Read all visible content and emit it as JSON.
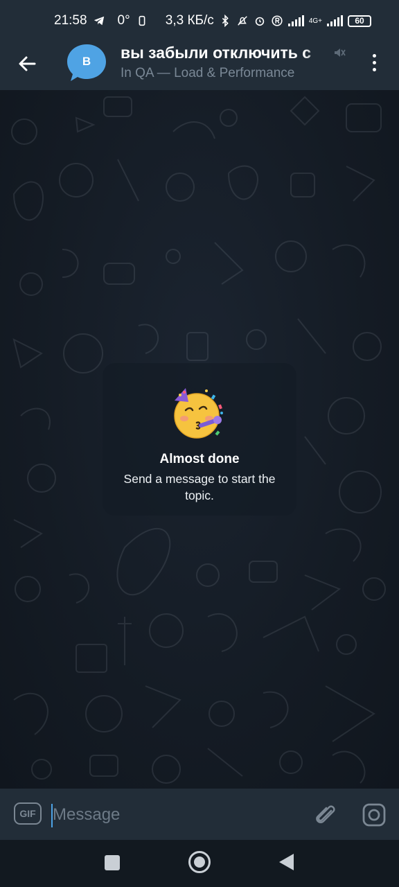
{
  "status_bar": {
    "time": "21:58",
    "temperature": "0°",
    "network_speed": "3,3 КБ/с",
    "network_type": "4G+",
    "battery": "60"
  },
  "header": {
    "avatar_letter": "B",
    "title": "вы забыли отключить с",
    "subtitle": "In QA — Load & Performance"
  },
  "empty_state": {
    "title": "Almost done",
    "subtitle": "Send a message to start the topic."
  },
  "composer": {
    "gif_label": "GIF",
    "placeholder": "Message"
  },
  "colors": {
    "accent": "#4da3e6",
    "avatar": "#4fa3e4",
    "header_bg": "#222d38",
    "chat_bg": "#151d27"
  },
  "icons": [
    "back-arrow-icon",
    "mute-icon",
    "more-vertical-icon",
    "party-emoji-icon",
    "gif-icon",
    "attach-icon",
    "camera-icon"
  ]
}
